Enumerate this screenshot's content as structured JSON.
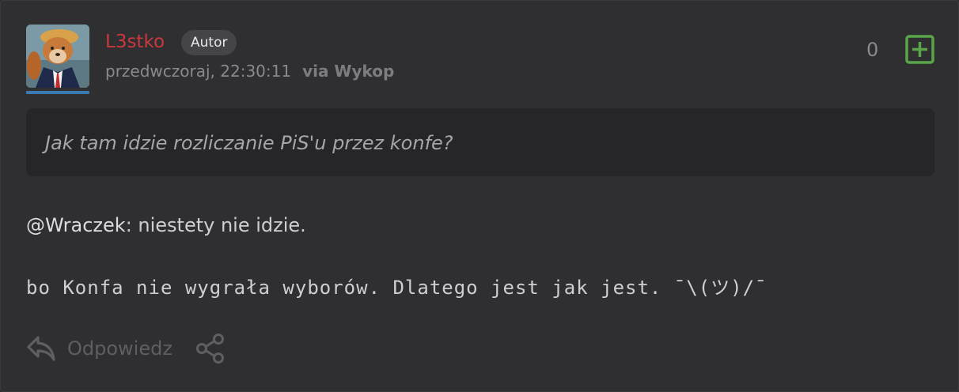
{
  "post": {
    "author": "L3stko",
    "badge": "Autor",
    "timestamp": "przedwczoraj, 22:30:11",
    "via": "via Wykop",
    "vote_count": "0",
    "quote": "Jak tam idzie rozliczanie PiS'u przez konfe?",
    "mention": "@Wraczek",
    "reply_text": ": niestety nie idzie.",
    "mono_line": "bo Konfa nie wygrała wyborów. Dlatego jest jak jest. ¯\\(ツ)/¯",
    "reply_label": "Odpowiedz"
  },
  "colors": {
    "author": "#c9383d",
    "plus_button": "#5aa54a",
    "avatar_underline": "#3b7ab0"
  },
  "icons": {
    "plus": "plus-square-icon",
    "reply": "reply-arrow-icon",
    "share": "share-icon"
  }
}
